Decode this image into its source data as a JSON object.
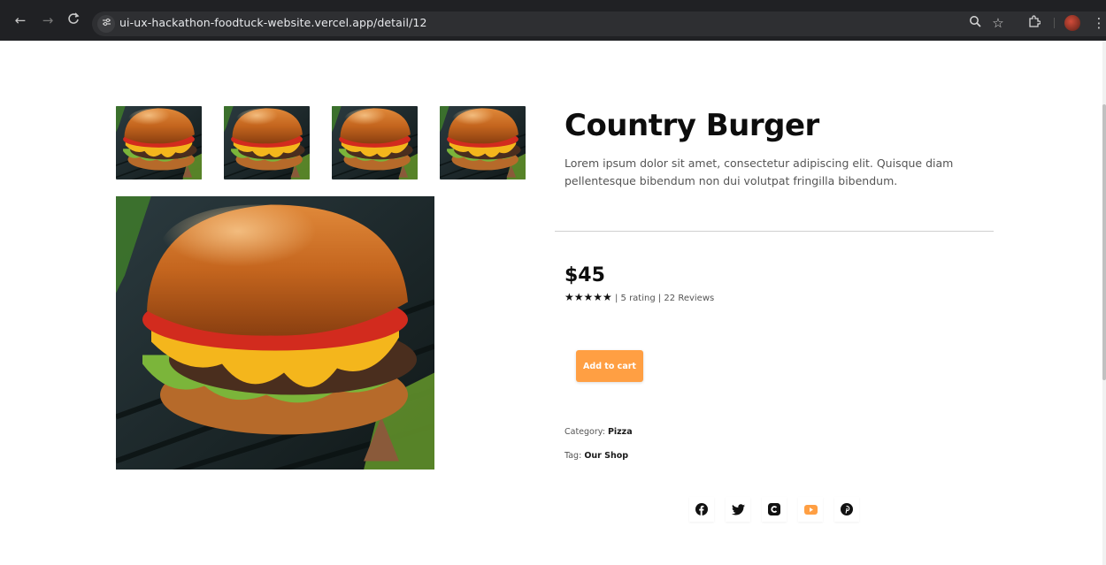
{
  "browser": {
    "url": "ui-ux-hackathon-foodtuck-website.vercel.app/detail/12",
    "nav": {
      "back_icon": "←",
      "forward_icon": "→",
      "reload_icon": "C"
    }
  },
  "gallery": {
    "thumbnails": [
      "burger-thumbnail-1",
      "burger-thumbnail-2",
      "burger-thumbnail-3",
      "burger-thumbnail-4"
    ],
    "main_image": "burger-main-image"
  },
  "product": {
    "title": "Country Burger",
    "description": "Lorem ipsum dolor sit amet, consectetur adipiscing elit. Quisque diam pellentesque bibendum non dui volutpat fringilla bibendum.",
    "price": "$45",
    "stars": "★★★★★",
    "rating_text": " | 5 rating | 22 Reviews",
    "rating_value": 5,
    "add_to_cart_label": "Add to cart",
    "category_label": "Category: ",
    "category_value": "Pizza",
    "tag_label": "Tag: ",
    "tag_value": "Our Shop"
  },
  "social": [
    "facebook-icon",
    "twitter-icon",
    "instagram-icon",
    "youtube-icon",
    "pinterest-icon"
  ],
  "colors": {
    "accent": "#ff9f43",
    "youtube": "#ff9f43",
    "chrome_bg": "#202124"
  }
}
